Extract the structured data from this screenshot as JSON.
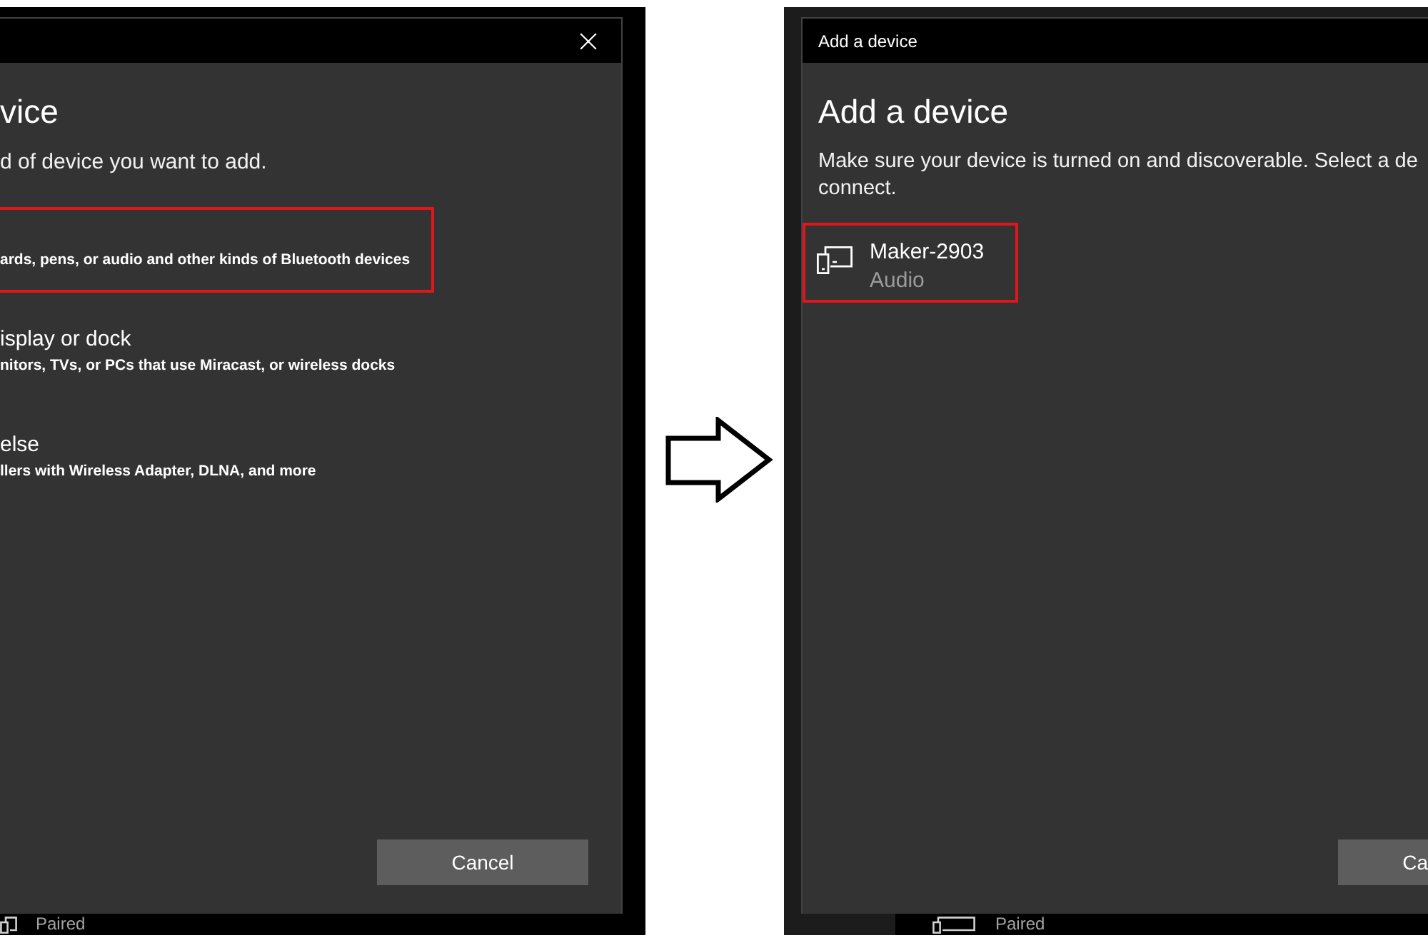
{
  "left_dialog": {
    "heading": "vice",
    "instruction": "d of device you want to add.",
    "device_types": [
      {
        "description": "ards, pens, or audio and other kinds of Bluetooth devices",
        "selected": true
      },
      {
        "title": "isplay or dock",
        "description": "nitors, TVs, or PCs that use Miracast, or wireless docks",
        "selected": false
      },
      {
        "title": "else",
        "description": "llers with Wireless Adapter, DLNA, and more",
        "selected": false
      }
    ],
    "cancel_button": "Cancel",
    "background_window": {
      "status_text": "Paired"
    }
  },
  "right_dialog": {
    "title": "Add a device",
    "heading": "Add a device",
    "instruction_lines": [
      "Make sure your device is turned on and discoverable. Select a de",
      "connect."
    ],
    "devices": [
      {
        "name": "Maker-2903",
        "type": "Audio",
        "selected": true
      }
    ],
    "cancel_button": "Ca",
    "background_window": {
      "status_text": "Paired"
    }
  }
}
